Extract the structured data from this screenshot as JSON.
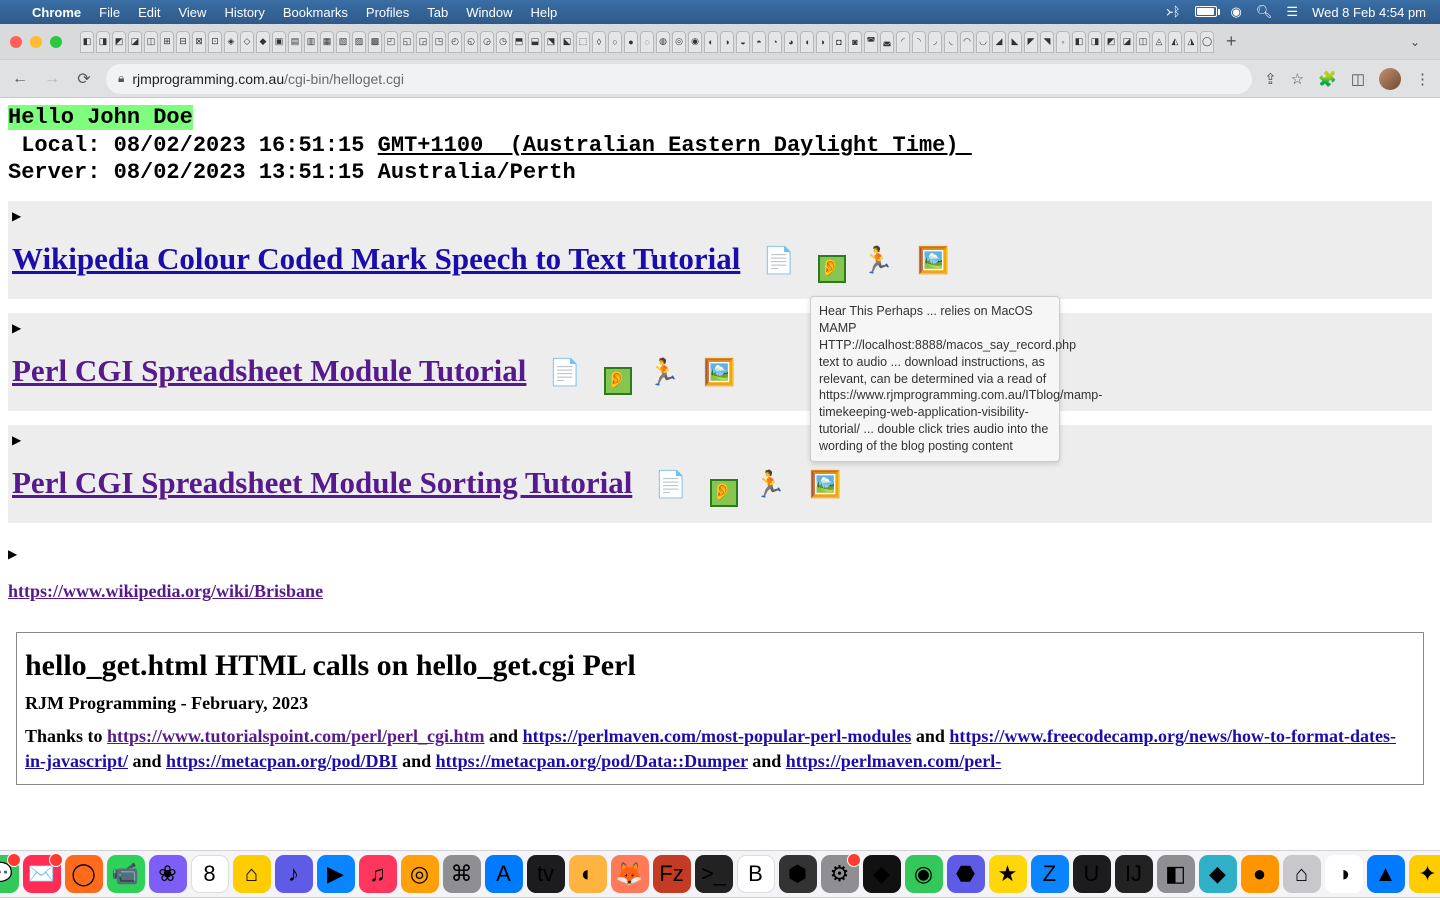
{
  "menubar": {
    "app": "Chrome",
    "items": [
      "File",
      "Edit",
      "View",
      "History",
      "Bookmarks",
      "Profiles",
      "Tab",
      "Window",
      "Help"
    ],
    "clock": "Wed 8 Feb  4:54 pm"
  },
  "browser": {
    "url_host": "rjmprogramming.com.au",
    "url_path": "/cgi-bin/helloget.cgi",
    "new_tab_plus": "+"
  },
  "page": {
    "hello": "Hello John Doe",
    "local_label": " Local: ",
    "local_ts": "08/02/2023 16:51:15 ",
    "tz_link": "GMT+1100  (Australian Eastern Daylight Time) ",
    "server_line": "Server: 08/02/2023 13:51:15 Australia/Perth",
    "sections": [
      {
        "title": "Wikipedia Colour Coded Mark Speech to Text Tutorial",
        "visited": false
      },
      {
        "title": "Perl CGI Spreadsheet Module Tutorial",
        "visited": true
      },
      {
        "title": "Perl CGI Spreadsheet Module Sorting Tutorial",
        "visited": true
      }
    ],
    "ext_link": "https://www.wikipedia.org/wiki/Brisbane",
    "tooltip": "Hear This Perhaps ... relies on MacOS MAMP HTTP://localhost:8888/macos_say_record.php text to audio ... download instructions, as relevant, can be determined via a read of https://www.rjmprogramming.com.au/ITblog/mamp-timekeeping-web-application-visibility-tutorial/ ... double click tries audio into the wording of the blog posting content"
  },
  "iframe": {
    "title": "hello_get.html HTML calls on hello_get.cgi Perl",
    "subtitle": "RJM Programming - February, 2023",
    "thanks_prefix": "Thanks to ",
    "and": " and ",
    "links": [
      "https://www.tutorialspoint.com/perl/perl_cgi.htm",
      "https://perlmaven.com/most-popular-perl-modules",
      "https://www.freecodecamp.org/news/how-to-format-dates-in-javascript/",
      "https://metacpan.org/pod/DBI",
      "https://metacpan.org/pod/Data::Dumper",
      "https://perlmaven.com/perl-"
    ]
  }
}
